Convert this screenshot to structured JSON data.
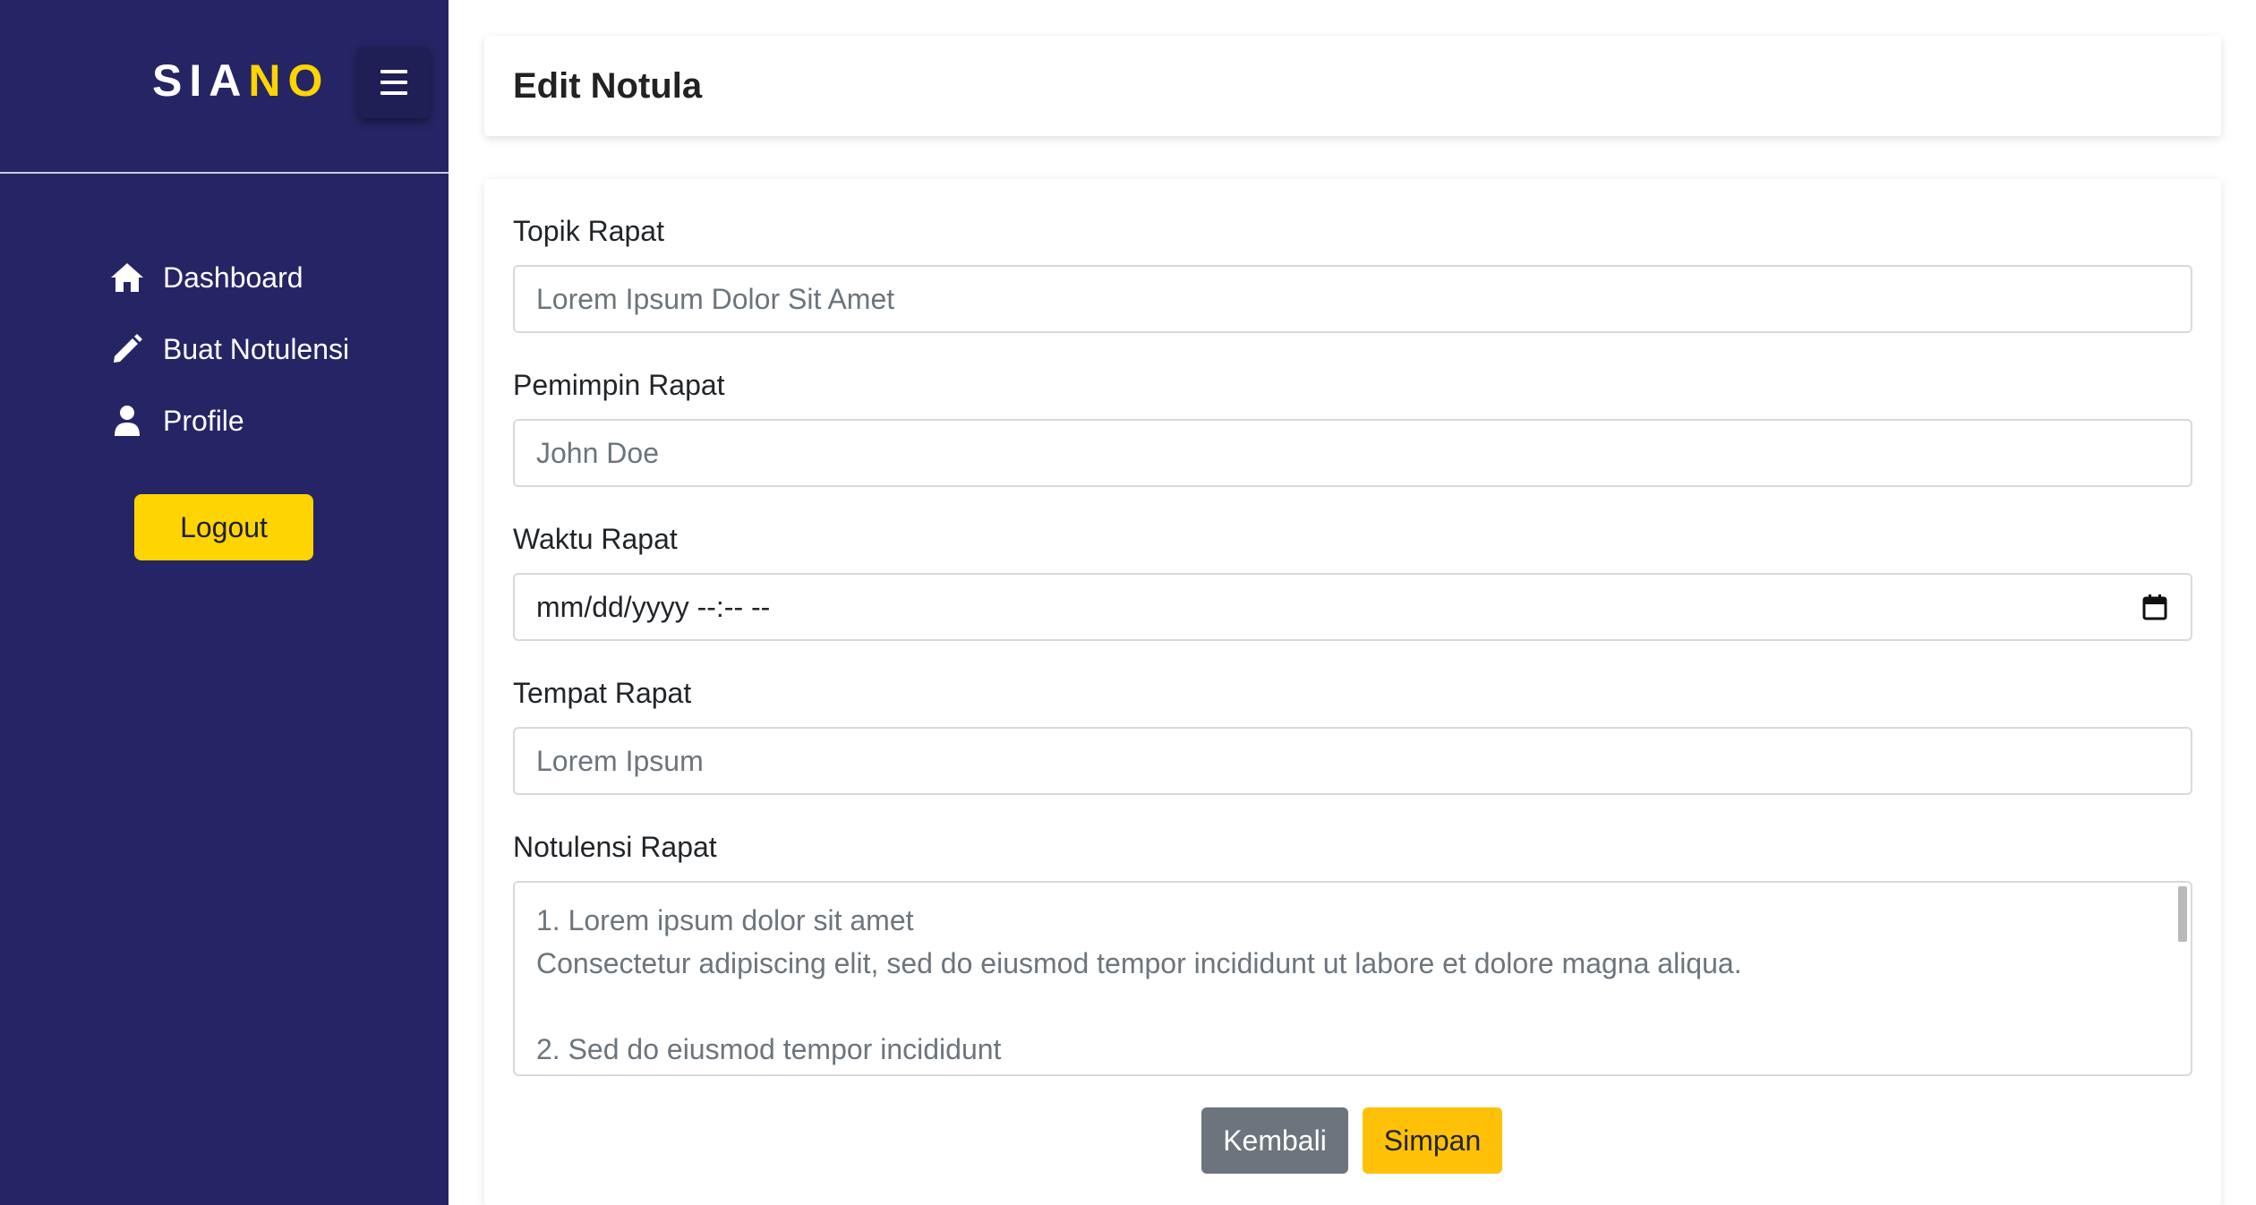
{
  "brand": {
    "part1": "SIA",
    "part2": "NO",
    "menu_icon": "hamburger-icon"
  },
  "sidebar": {
    "items": [
      {
        "label": "Dashboard",
        "icon": "home-icon"
      },
      {
        "label": "Buat Notulensi",
        "icon": "pencil-icon"
      },
      {
        "label": "Profile",
        "icon": "user-icon"
      }
    ],
    "logout_label": "Logout"
  },
  "header": {
    "title": "Edit Notula"
  },
  "form": {
    "topik": {
      "label": "Topik Rapat",
      "placeholder": "Lorem Ipsum Dolor Sit Amet"
    },
    "pemimpin": {
      "label": "Pemimpin Rapat",
      "placeholder": "John Doe"
    },
    "waktu": {
      "label": "Waktu Rapat",
      "value": "mm/dd/yyyy --:-- --",
      "icon": "calendar-icon"
    },
    "tempat": {
      "label": "Tempat Rapat",
      "placeholder": "Lorem Ipsum"
    },
    "notulensi": {
      "label": "Notulensi Rapat",
      "lines": [
        "1. Lorem ipsum dolor sit amet",
        "Consectetur adipiscing elit, sed do eiusmod tempor incididunt ut labore et dolore magna aliqua.",
        "",
        "2. Sed do eiusmod tempor incididunt"
      ]
    },
    "back_label": "Kembali",
    "save_label": "Simpan"
  },
  "colors": {
    "sidebar_bg": "#252566",
    "accent_yellow": "#ffd400",
    "save_button": "#ffc107",
    "back_button": "#6c757d"
  }
}
